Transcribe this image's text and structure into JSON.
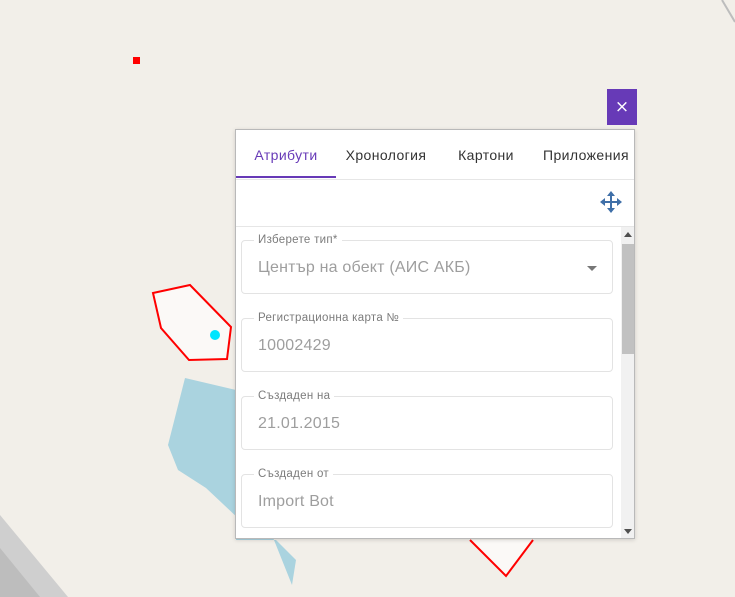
{
  "tabs": [
    {
      "label": "Атрибути",
      "active": true
    },
    {
      "label": "Хронология",
      "active": false
    },
    {
      "label": "Картони",
      "active": false
    },
    {
      "label": "Приложения",
      "active": false
    }
  ],
  "close_icon": "×",
  "icons": {
    "close": "close-icon",
    "move": "move-arrows-icon",
    "dropdown": "chevron-down-icon"
  },
  "fields": [
    {
      "label": "Изберете тип*",
      "value": "Център на обект (АИС АКБ)",
      "type": "select"
    },
    {
      "label": "Регистрационна карта №",
      "value": "10002429",
      "type": "text"
    },
    {
      "label": "Създаден на",
      "value": "21.01.2015",
      "type": "text"
    },
    {
      "label": "Създаден от",
      "value": "Import Bot",
      "type": "text"
    }
  ],
  "colors": {
    "accent": "#673ab7",
    "map_background": "#f2efe9",
    "water": "#aad3df",
    "parcel_outline": "#ff0000",
    "point": "#00e5ff",
    "road": "#c8c8c8"
  }
}
